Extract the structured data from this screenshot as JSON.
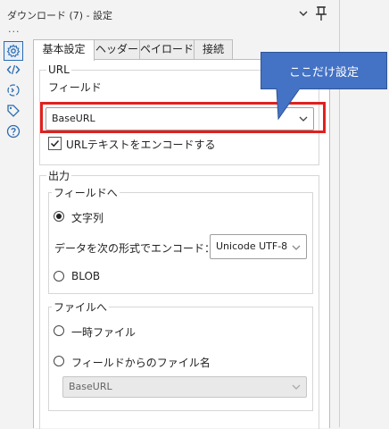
{
  "window": {
    "title": "ダウンロード (7) - 設定",
    "overflow_dots": "..."
  },
  "rail": {
    "icons": [
      "gear-icon",
      "code-icon",
      "transform-icon",
      "tag-icon",
      "help-icon"
    ]
  },
  "tabs": [
    {
      "label": "基本設定",
      "active": true
    },
    {
      "label": "ヘッダー",
      "active": false
    },
    {
      "label": "ペイロード",
      "active": false
    },
    {
      "label": "接続",
      "active": false
    }
  ],
  "url_section": {
    "title": "URL",
    "field_label": "フィールド",
    "field_value": "BaseURL",
    "encode_label": "URLテキストをエンコードする",
    "encode_checked": true
  },
  "output_section": {
    "title": "出力",
    "to_field": {
      "title": "フィールドへ",
      "string_label": "文字列",
      "string_selected": true,
      "encode_label": "データを次の形式でエンコード：",
      "encoding_value": "Unicode UTF-8",
      "blob_label": "BLOB",
      "blob_selected": false
    },
    "to_file": {
      "title": "ファイルへ",
      "temp_label": "一時ファイル",
      "temp_selected": false,
      "name_from_field_label": "フィールドからのファイル名",
      "name_from_field_selected": false,
      "field_value": "BaseURL"
    }
  },
  "callout": {
    "text": "ここだけ設定"
  },
  "colors": {
    "highlight": "#e02020",
    "callout": "#4472c4",
    "active_icon": "#2b6cb0"
  }
}
